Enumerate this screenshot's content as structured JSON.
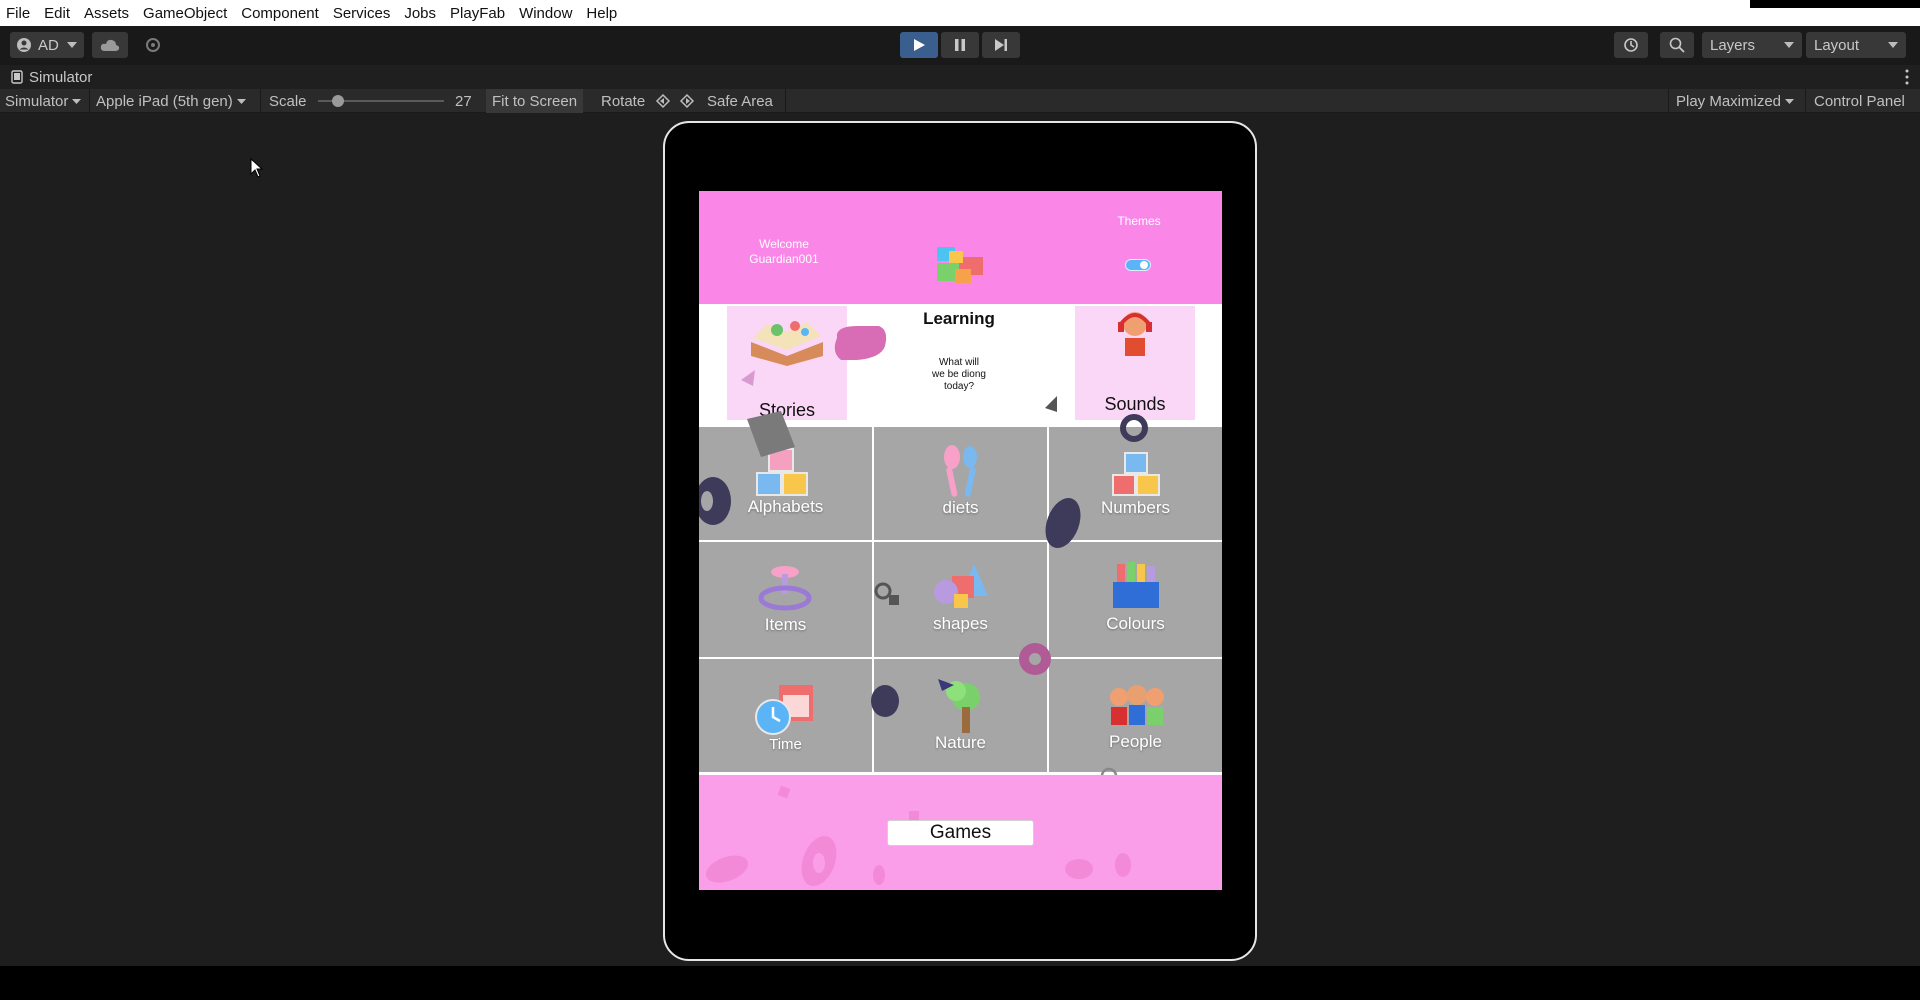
{
  "menu": [
    "File",
    "Edit",
    "Assets",
    "GameObject",
    "Component",
    "Services",
    "Jobs",
    "PlayFab",
    "Window",
    "Help"
  ],
  "toolbar": {
    "account": "AD",
    "layers": "Layers",
    "layout": "Layout"
  },
  "simulator": {
    "tab_title": "Simulator",
    "mode": "Simulator",
    "device": "Apple iPad (5th gen)",
    "scale_label": "Scale",
    "scale_value": "27",
    "scale_fraction": 0.12,
    "fit_to_screen": "Fit to Screen",
    "rotate": "Rotate",
    "safe_area": "Safe Area",
    "play_maximized": "Play Maximized",
    "control_panel": "Control Panel"
  },
  "app": {
    "welcome_line1": "Welcome",
    "welcome_line2": "Guardian001",
    "themes": "Themes",
    "learning_title": "Learning",
    "learning_sub_1": "What will",
    "learning_sub_2": "we be diong",
    "learning_sub_3": "today?",
    "stories": "Stories",
    "sounds": "Sounds",
    "grid": [
      {
        "label": "Alphabets",
        "icon": "abc-blocks-icon"
      },
      {
        "label": "diets",
        "icon": "utensils-icon"
      },
      {
        "label": "Numbers",
        "icon": "number-blocks-icon"
      },
      {
        "label": "Items",
        "icon": "toy-icon"
      },
      {
        "label": "shapes",
        "icon": "shapes-icon"
      },
      {
        "label": "Colours",
        "icon": "crayons-icon"
      },
      {
        "label": "Time",
        "icon": "clock-calendar-icon"
      },
      {
        "label": "Nature",
        "icon": "tree-icon"
      },
      {
        "label": "People",
        "icon": "people-icon"
      }
    ],
    "games": "Games"
  }
}
